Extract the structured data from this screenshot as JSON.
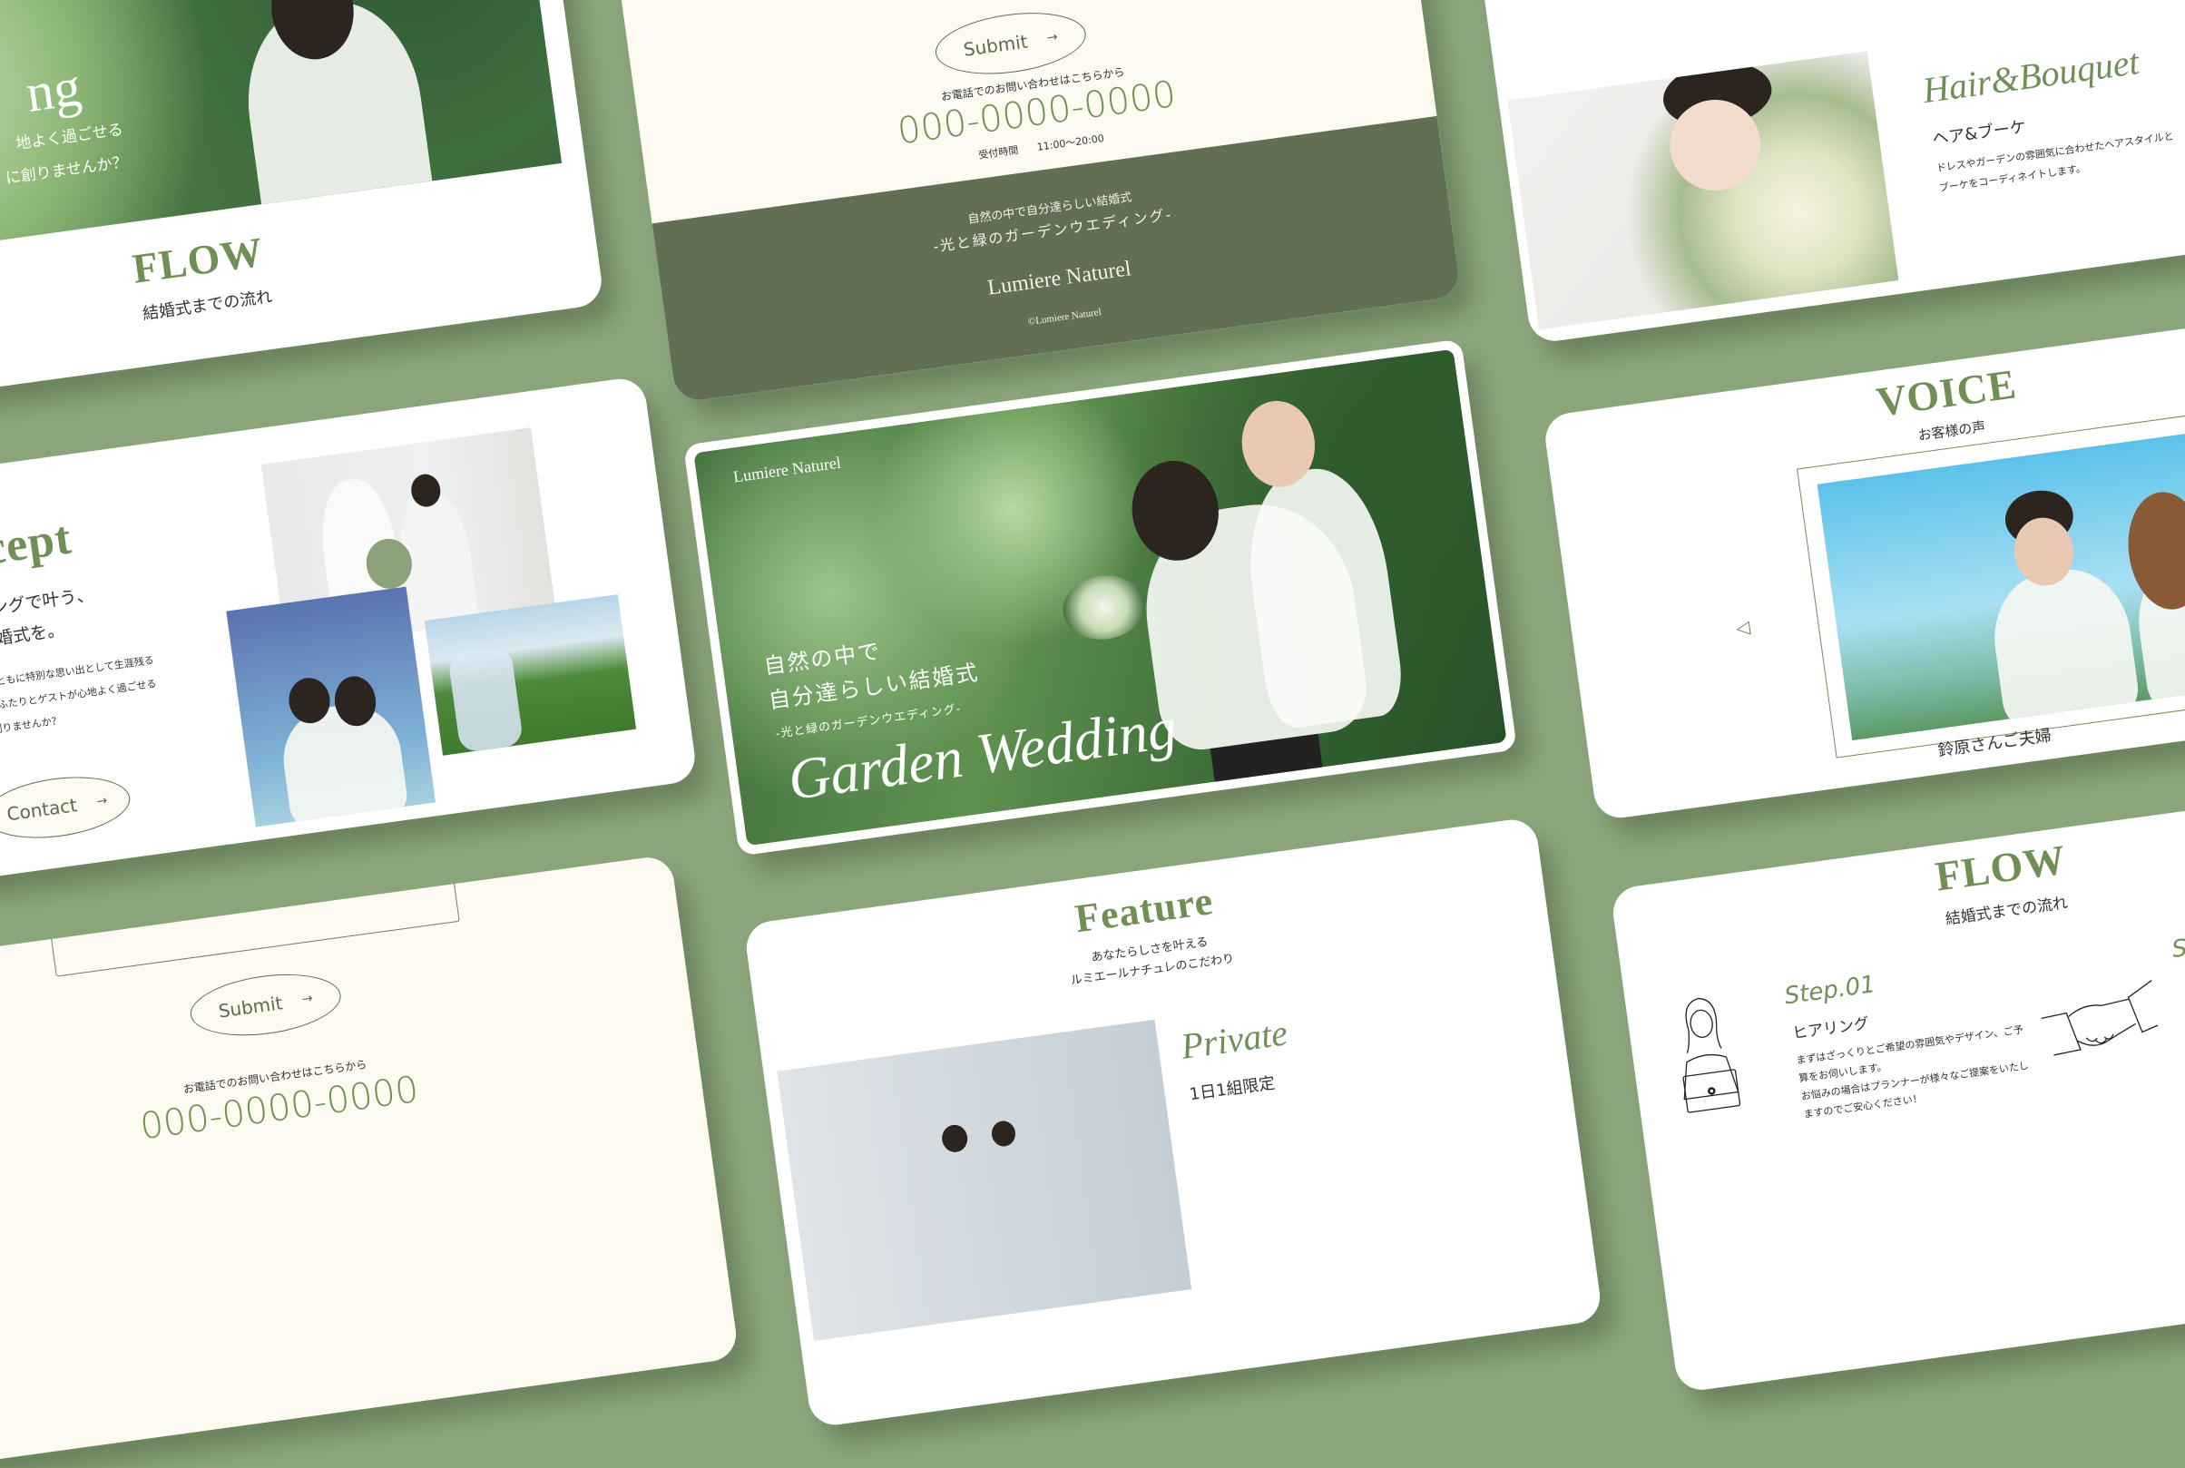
{
  "colors": {
    "background": "#8ca67c",
    "accent": "#6f8f55",
    "footer": "#616f55",
    "cream": "#fdfaf1"
  },
  "card_flow_top": {
    "hero_partial_title": "ng",
    "hero_partial_lines": [
      "地よく過ごせる",
      "に創りませんか？"
    ],
    "title": "FLOW",
    "subtitle": "結婚式までの流れ"
  },
  "card_contact": {
    "submit_label": "Submit",
    "submit_icon": "arrow-right-icon",
    "arrow": "→",
    "phone_label": "お電話でのお問い合わせはこちらから",
    "phone": "000-0000-0000",
    "hours_label": "受付時間",
    "hours": "11:00〜20:00",
    "footer_line1": "自然の中で自分達らしい結婚式",
    "footer_line2": "-光と緑のガーデンウエディング-",
    "footer_brand": "Lumiere Naturel",
    "copyright": "©Lumiere Naturel"
  },
  "card_hair": {
    "script_title": "Hair&Bouquet",
    "title": "ヘア&ブーケ",
    "desc": [
      "ドレスやガーデンの雰囲気に合わせたヘアスタイルと",
      "ブーケをコーディネイトします。"
    ]
  },
  "card_concept": {
    "title": "Concept",
    "lead": [
      "ンウエディングで叶う、",
      "ホームな結婚式を。"
    ],
    "body": [
      "や季節の移ろいとともに特別な思い出として生涯残る",
      "を演出します。おふたりとゲストが心地よく過ごせる",
      "私たちと一緒に創りませんか？"
    ],
    "contact_label": "Contact",
    "arrow": "→"
  },
  "hero": {
    "brand": "Lumiere Naturel",
    "headline": [
      "自然の中で",
      "自分達らしい結婚式"
    ],
    "subtitle": "-光と緑のガーデンウエディング-",
    "script": "Garden Wedding"
  },
  "card_voice": {
    "title": "VOICE",
    "subtitle": "お客様の声",
    "prev_icon": "◁",
    "name": "鈴原さんご夫婦"
  },
  "card_submit": {
    "submit_label": "Submit",
    "arrow": "→",
    "phone_label": "お電話でのお問い合わせはこちらから",
    "phone": "000-0000-0000"
  },
  "card_feature": {
    "title": "Feature",
    "subtitle": [
      "あなたらしさを叶える",
      "ルミエールナチュレのこだわり"
    ],
    "script": "Private",
    "item_title": "1日1組限定"
  },
  "card_flow": {
    "title": "FLOW",
    "subtitle": "結婚式までの流れ",
    "step": "Step.01",
    "step_title": "ヒアリング",
    "step_desc": [
      "まずはざっくりとご希望の雰囲気やデザイン、ご予",
      "算をお伺いします。",
      "お悩みの場合はプランナーが様々なご提案をいたし",
      "ますのでご安心ください！"
    ],
    "next_step_partial": "S"
  }
}
